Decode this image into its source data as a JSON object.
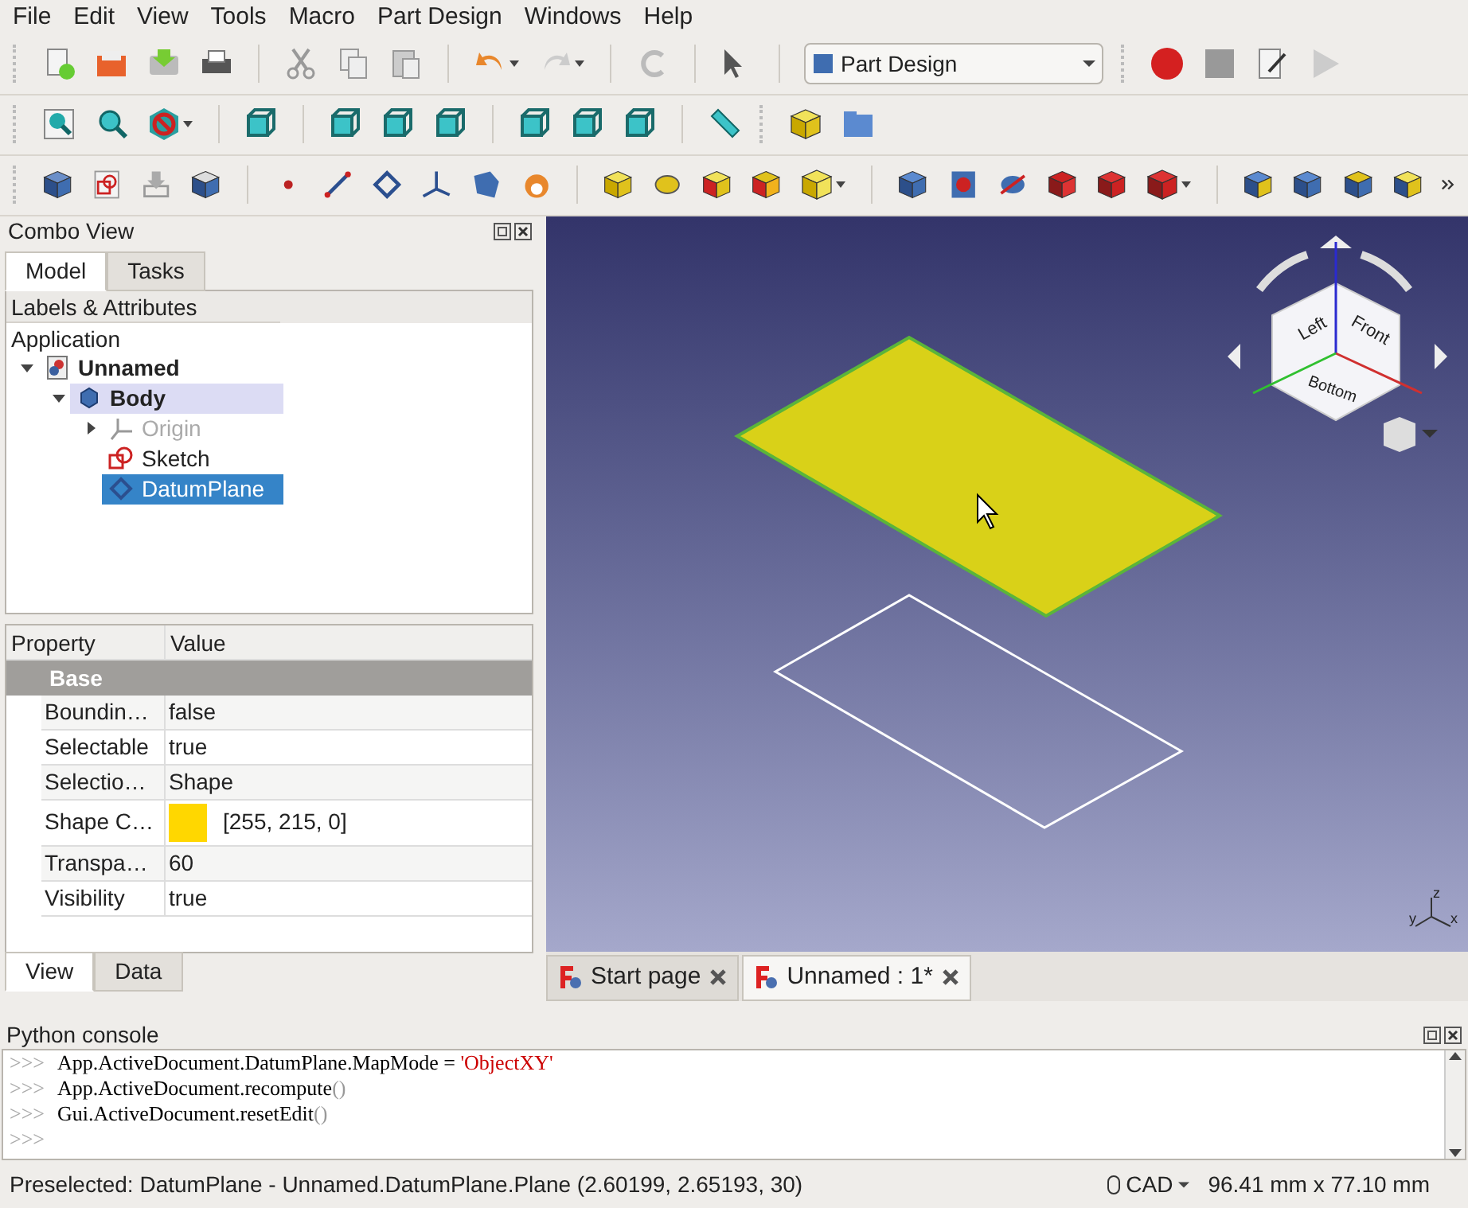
{
  "menu": [
    "File",
    "Edit",
    "View",
    "Tools",
    "Macro",
    "Part Design",
    "Windows",
    "Help"
  ],
  "workbench": "Part Design",
  "combo_view": {
    "title": "Combo View",
    "tabs": [
      {
        "label": "Model",
        "selected": true
      },
      {
        "label": "Tasks",
        "selected": false
      }
    ],
    "tree": {
      "header": "Labels & Attributes",
      "root": "Application",
      "items": [
        {
          "label": "Unnamed",
          "kind": "document",
          "bold": true,
          "expanded": true,
          "active": false,
          "disabled": false,
          "selected": false,
          "children": [
            {
              "label": "Body",
              "kind": "body",
              "bold": true,
              "expanded": true,
              "active": true,
              "disabled": false,
              "selected": false,
              "children": [
                {
                  "label": "Origin",
                  "kind": "origin",
                  "bold": false,
                  "expanded": false,
                  "active": false,
                  "disabled": true,
                  "selected": false
                },
                {
                  "label": "Sketch",
                  "kind": "sketch",
                  "bold": false,
                  "active": false,
                  "disabled": false,
                  "selected": false
                },
                {
                  "label": "DatumPlane",
                  "kind": "plane",
                  "bold": false,
                  "active": false,
                  "disabled": false,
                  "selected": true
                }
              ]
            }
          ]
        }
      ]
    }
  },
  "properties": {
    "columns": [
      "Property",
      "Value"
    ],
    "group": "Base",
    "rows": [
      {
        "name": "Boundin…",
        "value": "false"
      },
      {
        "name": "Selectable",
        "value": "true"
      },
      {
        "name": "Selectio…",
        "value": "Shape"
      },
      {
        "name": "Shape C…",
        "value": "[255, 215, 0]",
        "color": "#ffd700"
      },
      {
        "name": "Transpa…",
        "value": "60"
      },
      {
        "name": "Visibility",
        "value": "true"
      }
    ],
    "tabs": [
      {
        "label": "View",
        "selected": true
      },
      {
        "label": "Data",
        "selected": false
      }
    ]
  },
  "nav_cube": {
    "faces": [
      "Left",
      "Front",
      "Bottom"
    ],
    "axes": [
      "x",
      "y",
      "z"
    ]
  },
  "doc_tabs": [
    {
      "label": "Start page",
      "selected": false
    },
    {
      "label": "Unnamed : 1*",
      "selected": true
    }
  ],
  "console": {
    "title": "Python console",
    "lines": [
      {
        "prompt": ">>>",
        "parts": [
          {
            "text": "App.ActiveDocument.DatumPlane.MapMode = ",
            "kind": "code"
          },
          {
            "text": "'ObjectXY'",
            "kind": "string"
          }
        ]
      },
      {
        "prompt": ">>>",
        "parts": [
          {
            "text": "App.ActiveDocument.recompute",
            "kind": "code"
          },
          {
            "text": "()",
            "kind": "punct"
          }
        ]
      },
      {
        "prompt": ">>>",
        "parts": [
          {
            "text": "Gui.ActiveDocument.resetEdit",
            "kind": "code"
          },
          {
            "text": "()",
            "kind": "punct"
          }
        ]
      },
      {
        "prompt": ">>>"
      }
    ]
  },
  "status": {
    "message": "Preselected: DatumPlane - Unnamed.DatumPlane.Plane (2.60199, 2.65193, 30)",
    "nav_style": "CAD",
    "dimensions": "96.41 mm x 77.10 mm"
  }
}
